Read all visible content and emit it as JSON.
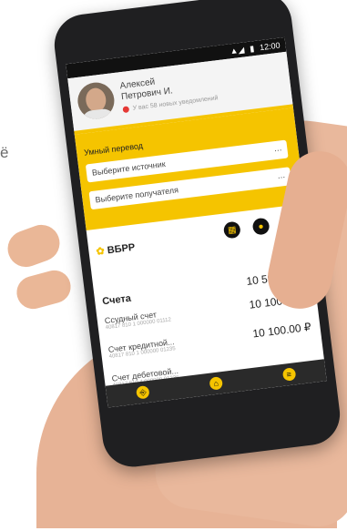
{
  "stray_char": "ё",
  "status": {
    "time": "12:00",
    "signal": "▲◢",
    "battery": "▮"
  },
  "profile": {
    "first_name": "Алексей",
    "last_name": "Петрович И.",
    "notifications": "У вас 58 новых уведомлений"
  },
  "transfer": {
    "title": "Умный перевод",
    "source_placeholder": "Выберите источник",
    "recipient_placeholder": "Выберите получателя",
    "more": "..."
  },
  "logo": {
    "star": "✿",
    "text": "ВБРР"
  },
  "icons": {
    "doc": "▦",
    "chat": "●",
    "mail": "✉"
  },
  "accounts": {
    "title": "Счета",
    "total": "10 591.00 ₽",
    "items": [
      {
        "name": "Ссудный счет",
        "number": "40817 810 1 000000 01112",
        "value": "10 100.00 ₽"
      },
      {
        "name": "Счет кредитной...",
        "number": "40817 810 1 000000 01235",
        "value": "10 100.00 ₽"
      },
      {
        "name": "Счет дебетовой...",
        "number": "40817 810 4 000000 01236",
        "value": ""
      }
    ]
  },
  "nav": {
    "left": "⎆",
    "home": "⌂",
    "menu": "≡"
  }
}
